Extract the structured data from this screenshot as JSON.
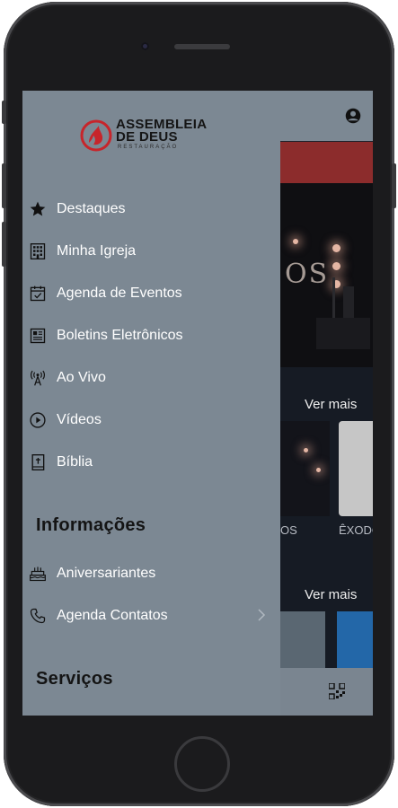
{
  "logo": {
    "line1": "ASSEMBLEIA",
    "line2": "DE DEUS",
    "subtitle": "RESTAURAÇÃO",
    "brand_color": "#c7252b"
  },
  "menu": {
    "items": [
      {
        "label": "Destaques",
        "icon": "star-icon"
      },
      {
        "label": "Minha Igreja",
        "icon": "building-icon"
      },
      {
        "label": "Agenda de Eventos",
        "icon": "calendar-check-icon"
      },
      {
        "label": "Boletins Eletrônicos",
        "icon": "newspaper-icon"
      },
      {
        "label": "Ao Vivo",
        "icon": "broadcast-tower-icon"
      },
      {
        "label": "Vídeos",
        "icon": "play-circle-icon"
      },
      {
        "label": "Bíblia",
        "icon": "bible-icon"
      }
    ],
    "informacoes": {
      "title": "Informações",
      "items": [
        {
          "label": "Aniversariantes",
          "icon": "birthday-cake-icon"
        },
        {
          "label": "Agenda Contatos",
          "icon": "phone-icon"
        }
      ]
    },
    "servicos": {
      "title": "Serviços"
    }
  },
  "background_app": {
    "hero_text": "OS",
    "ver_mais_1": "Ver mais",
    "ver_mais_2": "Ver mais",
    "thumb_label_1": "OS",
    "thumb_label_2": "ÊXODO"
  },
  "colors": {
    "drawer_bg": "#7c8893",
    "accent_red": "#8c2c2c"
  }
}
